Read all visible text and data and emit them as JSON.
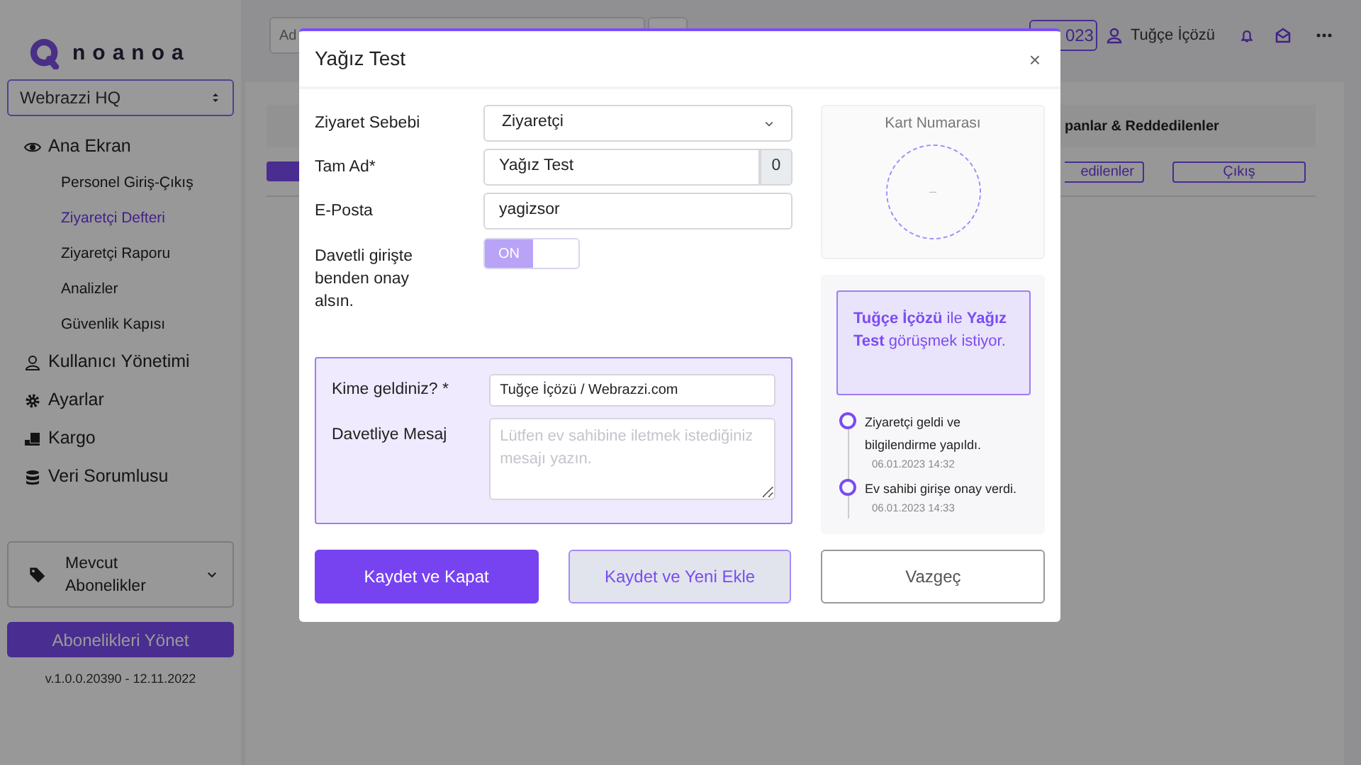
{
  "sidebar": {
    "logo": "noanoa",
    "org_select": {
      "value": "Webrazzi HQ"
    },
    "nav": [
      {
        "label": "Ana Ekran",
        "children": [
          {
            "label": "Personel Giriş-Çıkış",
            "selected": false
          },
          {
            "label": "Ziyaretçi Defteri",
            "selected": true
          },
          {
            "label": "Ziyaretçi Raporu",
            "selected": false
          },
          {
            "label": "Analizler",
            "selected": false
          },
          {
            "label": "Güvenlik Kapısı",
            "selected": false
          }
        ]
      },
      {
        "label": "Kullanıcı Yönetimi"
      },
      {
        "label": "Ayarlar"
      },
      {
        "label": "Kargo"
      },
      {
        "label": "Veri Sorumlusu"
      }
    ],
    "subscriptions": {
      "label": "Mevcut Abonelikler"
    },
    "manage_button": "Abonelikleri Yönet",
    "version": "v.1.0.0.20390 - 12.11.2022"
  },
  "header": {
    "search": {
      "placeholder": "Ad"
    },
    "date_badge": "023",
    "user": "Tuğçe İçözü"
  },
  "content": {
    "column_header": "panlar & Reddedilenler",
    "buttons": [
      "edilenler",
      "Çıkış"
    ]
  },
  "modal": {
    "title": "Yağız Test",
    "close": "×",
    "fields": [
      {
        "kind": "select",
        "label": "Ziyaret Sebebi",
        "value": "Ziyaretçi"
      },
      {
        "kind": "counter",
        "label": "Tam Ad*",
        "value": "Yağız Test",
        "count": "0"
      },
      {
        "kind": "text",
        "label": "E-Posta",
        "value": "yagizsor"
      },
      {
        "kind": "toggle",
        "label": "Davetli girişte benden onay alsın.",
        "on": true,
        "text": "ON"
      }
    ],
    "host": {
      "label": "Kime geldiniz? *",
      "value": "Tuğçe İçözü / Webrazzi.com",
      "message_label": "Davetliye Mesaj",
      "message_placeholder": "Lütfen ev sahibine iletmek istediğiniz mesajı yazın."
    },
    "card": {
      "title": "Kart Numarası",
      "value": "–"
    },
    "notice": "**Tuğçe İçözü** ile **Yağız Test** görüşmek istiyor.",
    "timeline": [
      {
        "text": "Ziyaretçi geldi ve bilgilendirme yapıldı.",
        "time": "06.01.2023 14:32"
      },
      {
        "text": "Ev sahibi girişe onay verdi.",
        "time": "06.01.2023 14:33"
      }
    ],
    "buttons": [
      {
        "kind": "primary",
        "label": "Kaydet ve Kapat"
      },
      {
        "kind": "secondary",
        "label": "Kaydet ve Yeni Ekle"
      },
      {
        "kind": "cancel",
        "label": "Vazgeç"
      }
    ]
  }
}
